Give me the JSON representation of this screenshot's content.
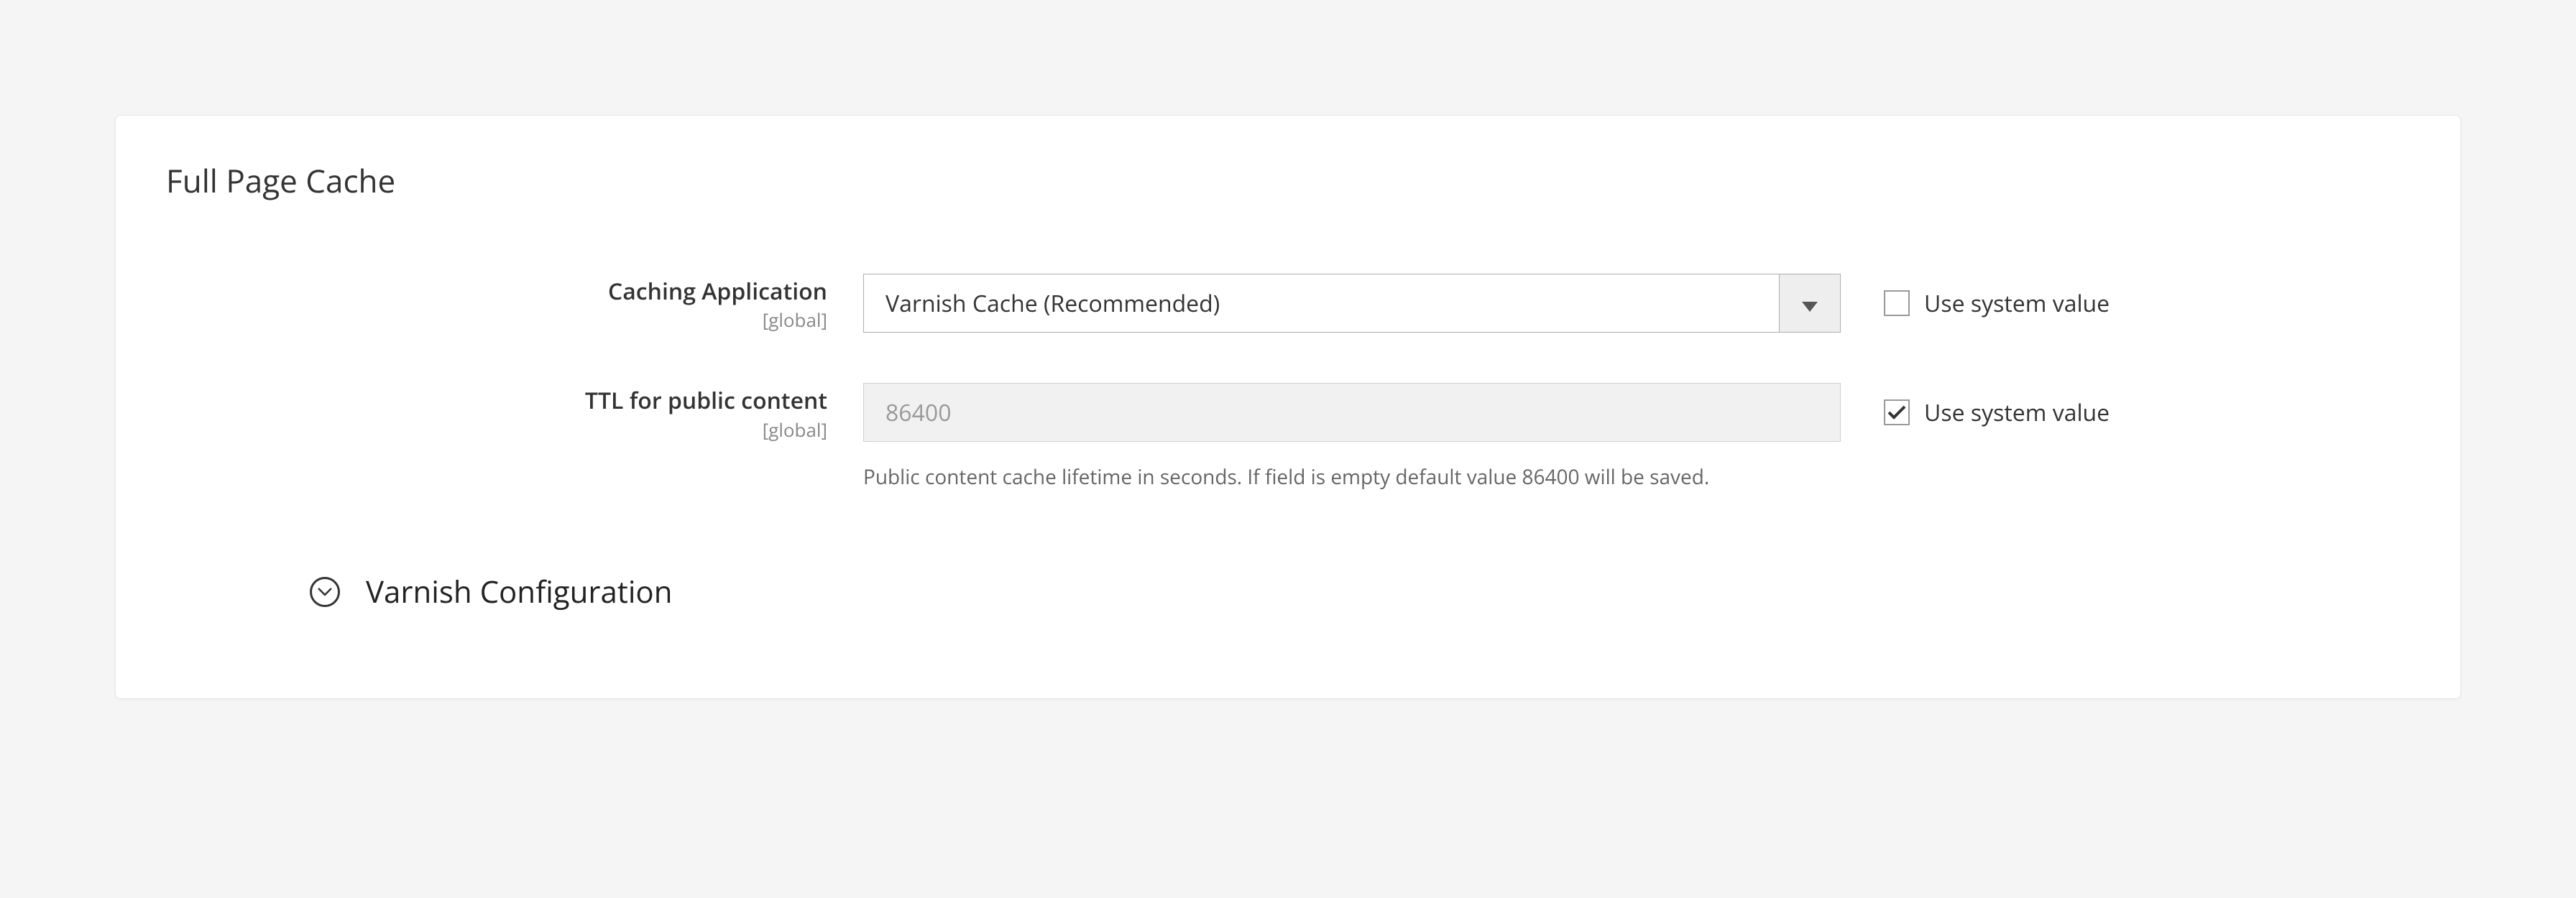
{
  "section": {
    "title": "Full Page Cache",
    "fields": {
      "caching_application": {
        "label": "Caching Application",
        "scope": "[global]",
        "value": "Varnish Cache (Recommended)",
        "use_system": false,
        "use_system_label": "Use system value"
      },
      "ttl_public": {
        "label": "TTL for public content",
        "scope": "[global]",
        "value": "86400",
        "help": "Public content cache lifetime in seconds. If field is empty default value 86400 will be saved.",
        "use_system": true,
        "use_system_label": "Use system value"
      }
    },
    "subsection": {
      "title": "Varnish Configuration"
    }
  }
}
